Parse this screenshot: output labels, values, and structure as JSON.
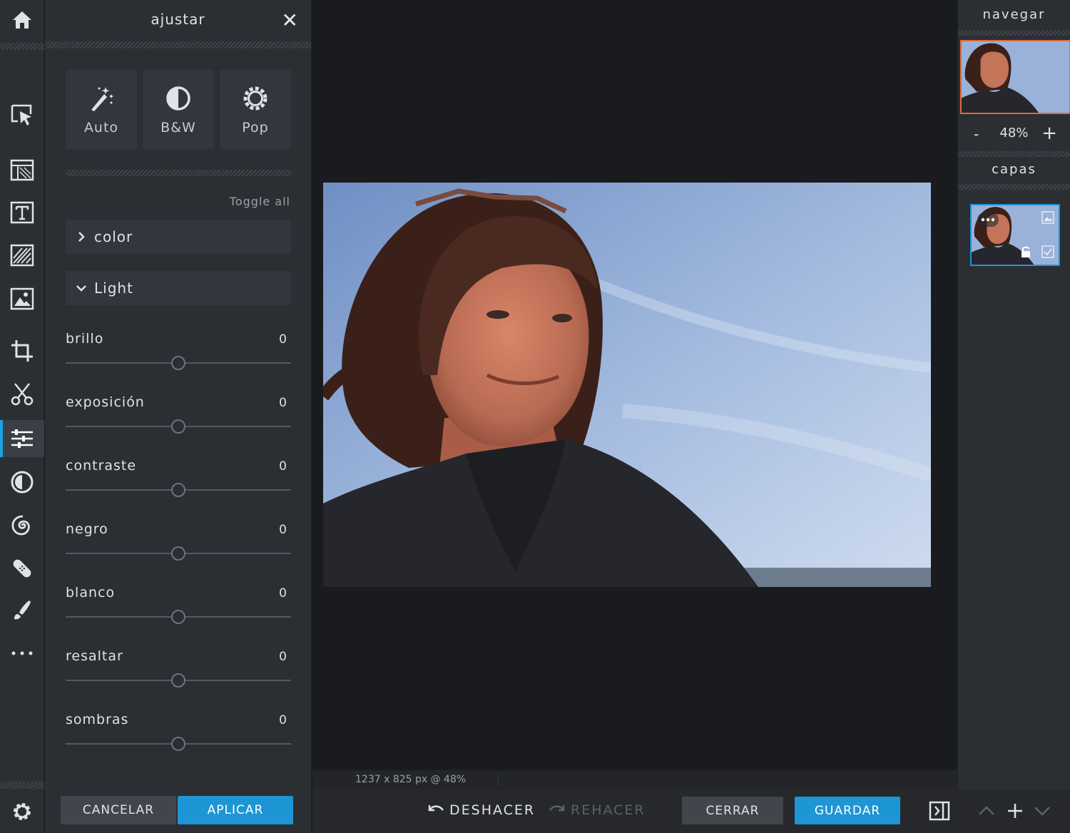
{
  "rail": {
    "tools": [
      {
        "name": "home-icon"
      },
      {
        "name": "select-arrow-icon"
      },
      {
        "name": "layout-icon"
      },
      {
        "name": "text-icon"
      },
      {
        "name": "pattern-icon"
      },
      {
        "name": "image-icon"
      },
      {
        "name": "crop-icon"
      },
      {
        "name": "scissors-icon"
      },
      {
        "name": "adjust-sliders-icon",
        "active": true
      },
      {
        "name": "contrast-icon"
      },
      {
        "name": "spiral-icon"
      },
      {
        "name": "bandage-icon"
      },
      {
        "name": "brush-icon"
      },
      {
        "name": "more-dots-icon"
      },
      {
        "name": "settings-gear-icon"
      }
    ]
  },
  "panel": {
    "title": "ajustar",
    "close": "✕",
    "presets": [
      {
        "label": "Auto",
        "icon": "magic-wand-icon"
      },
      {
        "label": "B&W",
        "icon": "half-circle-icon"
      },
      {
        "label": "Pop",
        "icon": "sun-gear-icon"
      }
    ],
    "toggle_all": "Toggle all",
    "sections": {
      "color": "color",
      "light": "Light"
    },
    "sliders": [
      {
        "label": "brillo",
        "value": "0",
        "position": 0.5
      },
      {
        "label": "exposición",
        "value": "0",
        "position": 0.5
      },
      {
        "label": "contraste",
        "value": "0",
        "position": 0.5
      },
      {
        "label": "negro",
        "value": "0",
        "position": 0.5
      },
      {
        "label": "blanco",
        "value": "0",
        "position": 0.5
      },
      {
        "label": "resaltar",
        "value": "0",
        "position": 0.5
      },
      {
        "label": "sombras",
        "value": "0",
        "position": 0.5
      }
    ],
    "cancel": "CANCELAR",
    "apply": "APLICAR"
  },
  "status": {
    "dimensions": "1237 x 825 px @ 48%"
  },
  "bottom": {
    "undo": "DESHACER",
    "redo": "REHACER",
    "close": "CERRAR",
    "save": "GUARDAR"
  },
  "right": {
    "navigate_title": "navegar",
    "zoom_minus": "-",
    "zoom_value": "48%",
    "zoom_plus": "+",
    "layers_title": "capas"
  },
  "colors": {
    "accent": "#1e95d4",
    "nav_border": "#e0683a"
  }
}
